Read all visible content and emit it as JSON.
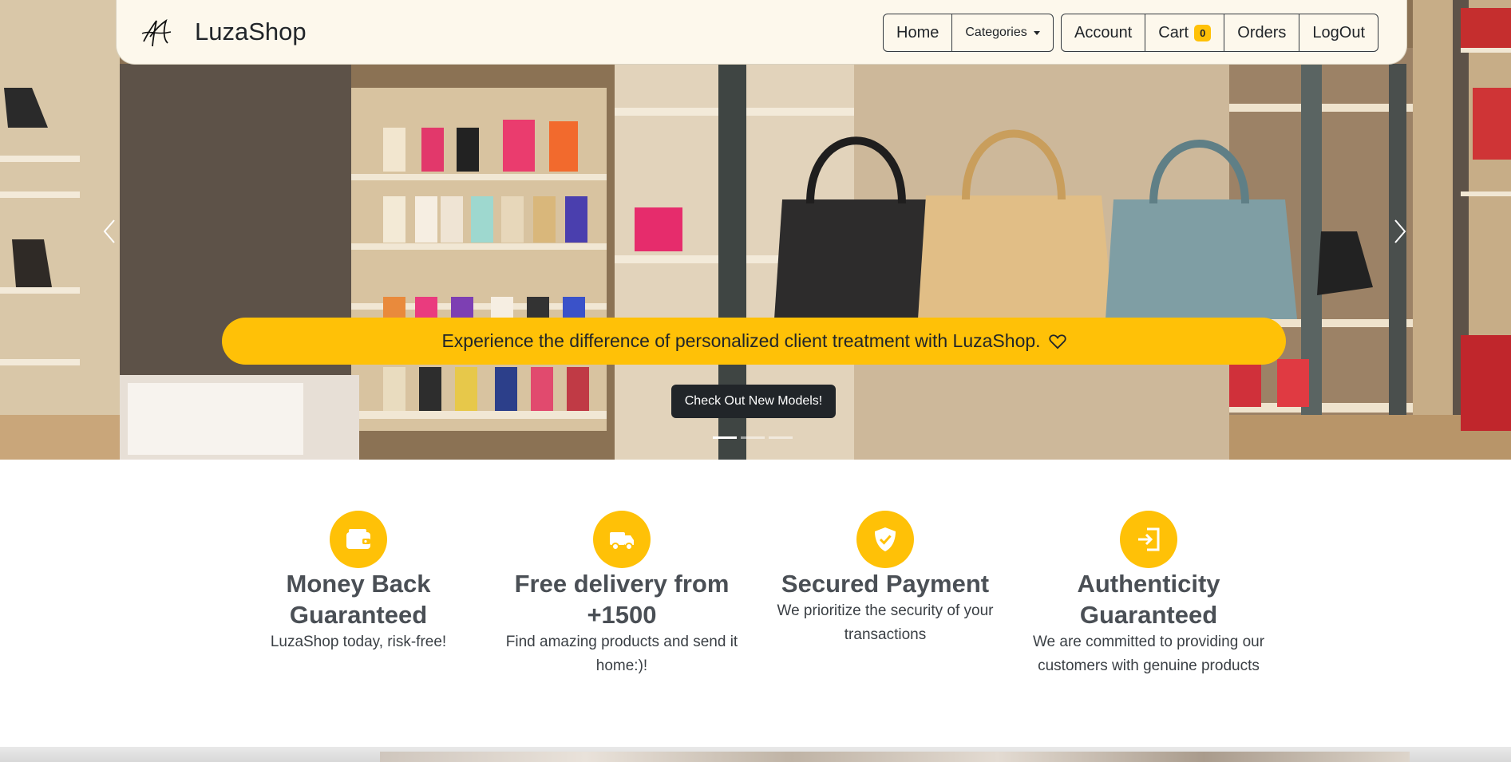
{
  "navbar": {
    "brand": "LuzaShop",
    "nav_left": [
      {
        "label": "Home"
      },
      {
        "label": "Categories"
      }
    ],
    "nav_right": [
      {
        "label": "Account"
      },
      {
        "label": "Cart",
        "badge": "0"
      },
      {
        "label": "Orders"
      },
      {
        "label": "LogOut"
      }
    ]
  },
  "hero": {
    "banner_text": "Experience the difference of personalized client treatment with LuzaShop.",
    "cta_label": "Check Out New Models!",
    "slide_count": 3,
    "active_slide": 1
  },
  "features": [
    {
      "icon": "wallet-icon",
      "title": "Money Back Guaranteed",
      "text": "LuzaShop today, risk-free!"
    },
    {
      "icon": "truck-icon",
      "title": "Free delivery from +1500",
      "text": "Find amazing products and send it home:)!"
    },
    {
      "icon": "shield-check-icon",
      "title": "Secured Payment",
      "text": "We prioritize the security of your transactions"
    },
    {
      "icon": "sign-in-icon",
      "title": "Authenticity Guaranteed",
      "text": "We are committed to providing our customers with genuine products"
    }
  ],
  "colors": {
    "accent": "#ffc107",
    "navbar_bg": "#fdf8ec",
    "dark": "#212529"
  }
}
